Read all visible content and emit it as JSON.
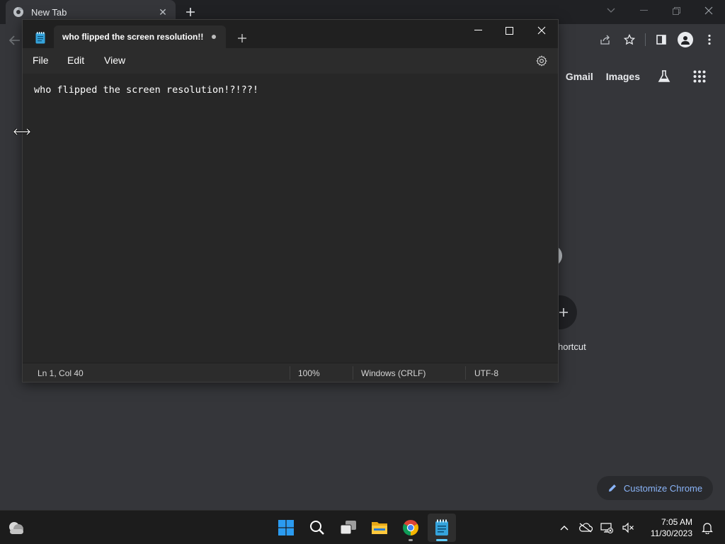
{
  "chrome": {
    "tab_title": "New Tab",
    "ntp_links": {
      "gmail": "Gmail",
      "images": "Images"
    },
    "shortcut_label": "hortcut",
    "customize_label": "Customize Chrome"
  },
  "notepad": {
    "tab_title": "who flipped the screen resolution!!",
    "menu": {
      "file": "File",
      "edit": "Edit",
      "view": "View"
    },
    "content": "who flipped the screen resolution!?!??!",
    "status": {
      "position": "Ln 1, Col 40",
      "zoom": "100%",
      "line_ending": "Windows (CRLF)",
      "encoding": "UTF-8"
    },
    "unsaved": true
  },
  "taskbar": {
    "apps": [
      "windows-start",
      "search",
      "task-view",
      "file-explorer",
      "chrome",
      "notepad"
    ],
    "active_app": "notepad",
    "clock": {
      "time": "7:05 AM",
      "date": "11/30/2023"
    }
  },
  "colors": {
    "accent": "#60cdff",
    "link_blue": "#8ab4f8",
    "chrome_bg": "#35363a",
    "notepad_bg": "#272727"
  }
}
